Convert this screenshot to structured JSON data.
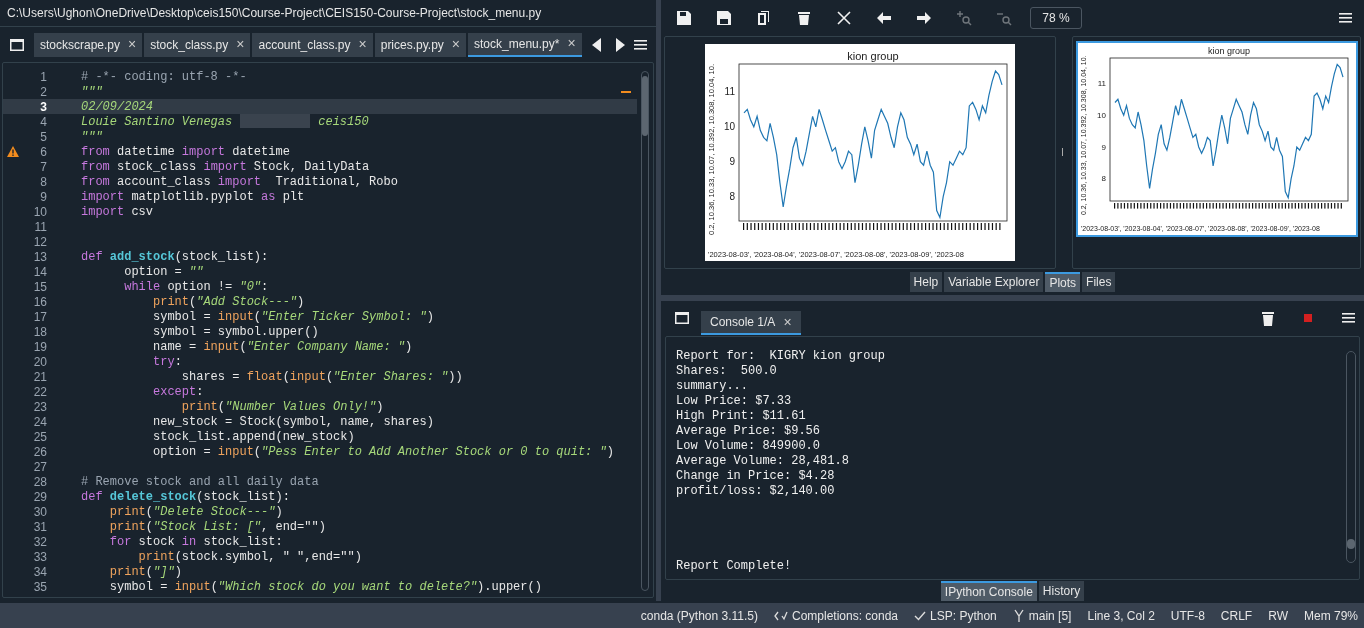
{
  "window": {
    "title": "C:\\Users\\Ughon\\OneDrive\\Desktop\\ceis150\\Course-Project\\CEIS150-Course-Project\\stock_menu.py"
  },
  "editor": {
    "tabs": [
      {
        "label": "stockscrape.py",
        "close": "×",
        "selected": false
      },
      {
        "label": "stock_class.py",
        "close": "×",
        "selected": false
      },
      {
        "label": "account_class.py",
        "close": "×",
        "selected": false
      },
      {
        "label": "prices.py.py",
        "close": "×",
        "selected": false
      },
      {
        "label": "stock_menu.py*",
        "close": "×",
        "selected": true
      }
    ],
    "lines": [
      {
        "number": "1",
        "current": false,
        "warning": false,
        "tokens": [
          {
            "kind": "comment",
            "text": "# -*- coding: utf-8 -*-"
          }
        ]
      },
      {
        "number": "2",
        "current": false,
        "warning": false,
        "tokens": [
          {
            "kind": "string",
            "text": "\"\"\""
          }
        ]
      },
      {
        "number": "3",
        "current": true,
        "warning": false,
        "tokens": [
          {
            "kind": "string",
            "text": "02/09/2024"
          }
        ]
      },
      {
        "number": "4",
        "current": false,
        "warning": false,
        "tokens": [
          {
            "kind": "string",
            "text": "Louie Santino Venegas"
          },
          {
            "kind": "redaction"
          },
          {
            "kind": "string",
            "text": "ceis150"
          }
        ]
      },
      {
        "number": "5",
        "current": false,
        "warning": false,
        "tokens": [
          {
            "kind": "string",
            "text": "\"\"\""
          }
        ]
      },
      {
        "number": "6",
        "current": false,
        "warning": true,
        "tokens": [
          {
            "kind": "keyword",
            "text": "from"
          },
          {
            "kind": "plain",
            "text": " datetime "
          },
          {
            "kind": "keyword",
            "text": "import"
          },
          {
            "kind": "plain",
            "text": " datetime"
          }
        ]
      },
      {
        "number": "7",
        "current": false,
        "warning": false,
        "tokens": [
          {
            "kind": "keyword",
            "text": "from"
          },
          {
            "kind": "plain",
            "text": " stock_class "
          },
          {
            "kind": "keyword",
            "text": "import"
          },
          {
            "kind": "plain",
            "text": " Stock, DailyData"
          }
        ]
      },
      {
        "number": "8",
        "current": false,
        "warning": false,
        "tokens": [
          {
            "kind": "keyword",
            "text": "from"
          },
          {
            "kind": "plain",
            "text": " account_class "
          },
          {
            "kind": "keyword",
            "text": "import"
          },
          {
            "kind": "plain",
            "text": "  Traditional, Robo"
          }
        ]
      },
      {
        "number": "9",
        "current": false,
        "warning": false,
        "tokens": [
          {
            "kind": "keyword",
            "text": "import"
          },
          {
            "kind": "plain",
            "text": " matplotlib.pyplot "
          },
          {
            "kind": "keyword",
            "text": "as"
          },
          {
            "kind": "plain",
            "text": " plt"
          }
        ]
      },
      {
        "number": "10",
        "current": false,
        "warning": false,
        "tokens": [
          {
            "kind": "keyword",
            "text": "import"
          },
          {
            "kind": "plain",
            "text": " csv"
          }
        ]
      },
      {
        "number": "11",
        "current": false,
        "warning": false
      },
      {
        "number": "12",
        "current": false,
        "warning": false
      },
      {
        "number": "13",
        "current": false,
        "warning": false,
        "tokens": [
          {
            "kind": "keyword",
            "text": "def "
          },
          {
            "kind": "defname",
            "text": "add_stock"
          },
          {
            "kind": "plain",
            "text": "(stock_list):"
          }
        ]
      },
      {
        "number": "14",
        "current": false,
        "warning": false,
        "tokens": [
          {
            "kind": "plain",
            "text": "      option = "
          },
          {
            "kind": "string",
            "text": "\"\""
          }
        ]
      },
      {
        "number": "15",
        "current": false,
        "warning": false,
        "tokens": [
          {
            "kind": "keyword",
            "text": "      while"
          },
          {
            "kind": "plain",
            "text": " option != "
          },
          {
            "kind": "string",
            "text": "\"0\""
          },
          {
            "kind": "plain",
            "text": ":"
          }
        ]
      },
      {
        "number": "16",
        "current": false,
        "warning": false,
        "tokens": [
          {
            "kind": "builtin",
            "text": "          print"
          },
          {
            "kind": "plain",
            "text": "("
          },
          {
            "kind": "string",
            "text": "\"Add Stock---\""
          },
          {
            "kind": "plain",
            "text": ")"
          }
        ]
      },
      {
        "number": "17",
        "current": false,
        "warning": false,
        "tokens": [
          {
            "kind": "plain",
            "text": "          symbol = "
          },
          {
            "kind": "builtin",
            "text": "input"
          },
          {
            "kind": "plain",
            "text": "("
          },
          {
            "kind": "string",
            "text": "\"Enter Ticker Symbol: \""
          },
          {
            "kind": "plain",
            "text": ")"
          }
        ]
      },
      {
        "number": "18",
        "current": false,
        "warning": false,
        "tokens": [
          {
            "kind": "plain",
            "text": "          symbol = symbol.upper()"
          }
        ]
      },
      {
        "number": "19",
        "current": false,
        "warning": false,
        "tokens": [
          {
            "kind": "plain",
            "text": "          name = "
          },
          {
            "kind": "builtin",
            "text": "input"
          },
          {
            "kind": "plain",
            "text": "("
          },
          {
            "kind": "string",
            "text": "\"Enter Company Name: \""
          },
          {
            "kind": "plain",
            "text": ")"
          }
        ]
      },
      {
        "number": "20",
        "current": false,
        "warning": false,
        "tokens": [
          {
            "kind": "keyword",
            "text": "          try"
          },
          {
            "kind": "plain",
            "text": ":"
          }
        ]
      },
      {
        "number": "21",
        "current": false,
        "warning": false,
        "tokens": [
          {
            "kind": "plain",
            "text": "              shares = "
          },
          {
            "kind": "builtin",
            "text": "float"
          },
          {
            "kind": "plain",
            "text": "("
          },
          {
            "kind": "builtin",
            "text": "input"
          },
          {
            "kind": "plain",
            "text": "("
          },
          {
            "kind": "string",
            "text": "\"Enter Shares: \""
          },
          {
            "kind": "plain",
            "text": "))"
          }
        ]
      },
      {
        "number": "22",
        "current": false,
        "warning": false,
        "tokens": [
          {
            "kind": "keyword",
            "text": "          except"
          },
          {
            "kind": "plain",
            "text": ":"
          }
        ]
      },
      {
        "number": "23",
        "current": false,
        "warning": false,
        "tokens": [
          {
            "kind": "builtin",
            "text": "              print"
          },
          {
            "kind": "plain",
            "text": "("
          },
          {
            "kind": "string",
            "text": "\"Number Values Only!\""
          },
          {
            "kind": "plain",
            "text": ")"
          }
        ]
      },
      {
        "number": "24",
        "current": false,
        "warning": false,
        "tokens": [
          {
            "kind": "plain",
            "text": "          new_stock = Stock(symbol, name, shares)"
          }
        ]
      },
      {
        "number": "25",
        "current": false,
        "warning": false,
        "tokens": [
          {
            "kind": "plain",
            "text": "          stock_list.append(new_stock)"
          }
        ]
      },
      {
        "number": "26",
        "current": false,
        "warning": false,
        "tokens": [
          {
            "kind": "plain",
            "text": "          option = "
          },
          {
            "kind": "builtin",
            "text": "input"
          },
          {
            "kind": "plain",
            "text": "("
          },
          {
            "kind": "string",
            "text": "\"Pess Enter to Add Another Stock or 0 to quit: \""
          },
          {
            "kind": "plain",
            "text": ")"
          }
        ]
      },
      {
        "number": "27",
        "current": false,
        "warning": false
      },
      {
        "number": "28",
        "current": false,
        "warning": false,
        "tokens": [
          {
            "kind": "comment",
            "text": "# Remove stock and all daily data"
          }
        ]
      },
      {
        "number": "29",
        "current": false,
        "warning": false,
        "tokens": [
          {
            "kind": "keyword",
            "text": "def "
          },
          {
            "kind": "defname",
            "text": "delete_stock"
          },
          {
            "kind": "plain",
            "text": "(stock_list):"
          }
        ]
      },
      {
        "number": "30",
        "current": false,
        "warning": false,
        "tokens": [
          {
            "kind": "builtin",
            "text": "    print"
          },
          {
            "kind": "plain",
            "text": "("
          },
          {
            "kind": "string",
            "text": "\"Delete Stock---\""
          },
          {
            "kind": "plain",
            "text": ")"
          }
        ]
      },
      {
        "number": "31",
        "current": false,
        "warning": false,
        "tokens": [
          {
            "kind": "builtin",
            "text": "    print"
          },
          {
            "kind": "plain",
            "text": "("
          },
          {
            "kind": "string",
            "text": "\"Stock List: [\""
          },
          {
            "kind": "plain",
            "text": ", end=\"\")"
          }
        ]
      },
      {
        "number": "32",
        "current": false,
        "warning": false,
        "tokens": [
          {
            "kind": "keyword",
            "text": "    for"
          },
          {
            "kind": "plain",
            "text": " stock "
          },
          {
            "kind": "keyword",
            "text": "in"
          },
          {
            "kind": "plain",
            "text": " stock_list:"
          }
        ]
      },
      {
        "number": "33",
        "current": false,
        "warning": false,
        "tokens": [
          {
            "kind": "builtin",
            "text": "        print"
          },
          {
            "kind": "plain",
            "text": "(stock.symbol, \" \",end=\"\")"
          }
        ]
      },
      {
        "number": "34",
        "current": false,
        "warning": false,
        "tokens": [
          {
            "kind": "builtin",
            "text": "    print"
          },
          {
            "kind": "plain",
            "text": "("
          },
          {
            "kind": "string",
            "text": "\"]\""
          },
          {
            "kind": "plain",
            "text": ")"
          }
        ]
      },
      {
        "number": "35",
        "current": false,
        "warning": false,
        "tokens": [
          {
            "kind": "plain",
            "text": "    symbol = "
          },
          {
            "kind": "builtin",
            "text": "input"
          },
          {
            "kind": "plain",
            "text": "("
          },
          {
            "kind": "string",
            "text": "\"Which stock do you want to delete?\""
          },
          {
            "kind": "plain",
            "text": ").upper()"
          }
        ]
      }
    ]
  },
  "plots": {
    "zoom": "78 %",
    "main": {
      "chart_data": {
        "type": "line",
        "title": "kion group",
        "xlabel": "'2023-08-03', '2023-08-04', '2023-08-07', '2023-08-08', '2023-08-09', '2023-08",
        "ylabel": "0.2, 10.36, 10.33, 10.07, 10.392, 10.308, 10.04, 10.",
        "ylim": [
          7.3,
          11.8
        ],
        "yticks": [
          8,
          9,
          10,
          11
        ],
        "series": [
          {
            "color": "#1f77b4",
            "values": [
              10.4,
              10.5,
              10.2,
              10.0,
              10.3,
              9.9,
              9.7,
              9.6,
              10.1,
              9.7,
              9.2,
              8.4,
              7.7,
              8.3,
              8.8,
              9.4,
              9.7,
              9.1,
              8.9,
              9.3,
              9.8,
              10.3,
              10.0,
              10.5,
              10.2,
              9.9,
              9.6,
              9.3,
              9.4,
              9.0,
              8.8,
              9.0,
              9.3,
              9.2,
              8.4,
              8.9,
              9.5,
              10.0,
              9.6,
              9.1,
              9.9,
              10.2,
              10.5,
              10.3,
              10.1,
              9.7,
              9.4,
              10.0,
              10.4,
              10.2,
              9.7,
              9.5,
              9.2,
              9.5,
              9.0,
              8.9,
              9.3,
              8.9,
              8.7,
              7.6,
              7.4,
              8.0,
              8.4,
              9.0,
              8.9,
              9.1,
              9.3,
              9.2,
              9.4,
              10.6,
              10.7,
              10.5,
              10.2,
              10.6,
              10.4,
              10.9,
              11.3,
              11.6,
              11.5,
              11.2
            ]
          }
        ]
      }
    },
    "thumbnails": [
      {
        "selected": true,
        "chart_data": {
          "type": "line",
          "title": "kion group",
          "xlabel": "'2023-08-03', '2023-08-04', '2023-08-07', '2023-08-08', '2023-08-09', '2023-08",
          "ylabel": "0.2, 10.36, 10.33, 10.07, 10.392, 10.308, 10.04, 10.",
          "ylim": [
            7.3,
            11.8
          ],
          "yticks": [
            8,
            9,
            10,
            11
          ],
          "series": [
            {
              "color": "#1f77b4",
              "values": [
                10.4,
                10.5,
                10.2,
                10.0,
                10.3,
                9.9,
                9.7,
                9.6,
                10.1,
                9.7,
                9.2,
                8.4,
                7.7,
                8.3,
                8.8,
                9.4,
                9.7,
                9.1,
                8.9,
                9.3,
                9.8,
                10.3,
                10.0,
                10.5,
                10.2,
                9.9,
                9.6,
                9.3,
                9.4,
                9.0,
                8.8,
                9.0,
                9.3,
                9.2,
                8.4,
                8.9,
                9.5,
                10.0,
                9.6,
                9.1,
                9.9,
                10.2,
                10.5,
                10.3,
                10.1,
                9.7,
                9.4,
                10.0,
                10.4,
                10.2,
                9.7,
                9.5,
                9.2,
                9.5,
                9.0,
                8.9,
                9.3,
                8.9,
                8.7,
                7.6,
                7.4,
                8.0,
                8.4,
                9.0,
                8.9,
                9.1,
                9.3,
                9.2,
                9.4,
                10.6,
                10.7,
                10.5,
                10.2,
                10.6,
                10.4,
                10.9,
                11.3,
                11.6,
                11.5,
                11.2
              ]
            }
          ]
        }
      }
    ],
    "pane_tabs": [
      {
        "label": "Help",
        "selected": false
      },
      {
        "label": "Variable Explorer",
        "selected": false
      },
      {
        "label": "Plots",
        "selected": true
      },
      {
        "label": "Files",
        "selected": false
      }
    ]
  },
  "console": {
    "tabs": [
      {
        "label": "Console 1/A",
        "close": "×",
        "selected": true
      }
    ],
    "output": "Report for:  KIGRY kion group\nShares:  500.0\nsummary...\nLow Price: $7.33\nHigh Print: $11.61\nAverage Price: $9.56\nLow Volume: 849900.0\nAverage Volume: 28,481.8\nChange in Price: $4.28\nprofit/loss: $2,140.00\n\n\n\n\nReport Complete!",
    "pane_tabs": [
      {
        "label": "IPython Console",
        "selected": true
      },
      {
        "label": "History",
        "selected": false
      }
    ]
  },
  "status_bar": [
    {
      "kind": "text",
      "text": "conda (Python 3.11.5)"
    },
    {
      "kind": "completions",
      "text": "Completions: conda"
    },
    {
      "kind": "check",
      "text": "LSP: Python"
    },
    {
      "kind": "branch",
      "text": "main [5]"
    },
    {
      "kind": "text",
      "text": "Line 3, Col 2"
    },
    {
      "kind": "text",
      "text": "UTF-8"
    },
    {
      "kind": "text",
      "text": "CRLF"
    },
    {
      "kind": "text",
      "text": "RW"
    },
    {
      "kind": "text",
      "text": "Mem 79%"
    }
  ]
}
